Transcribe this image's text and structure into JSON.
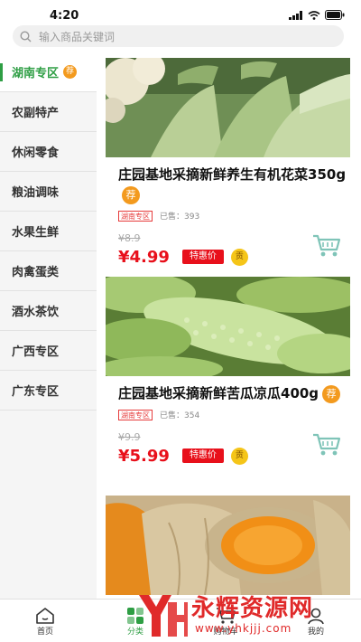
{
  "status_bar": {
    "time": "4:20"
  },
  "search": {
    "placeholder": "输入商品关键词"
  },
  "sidebar": {
    "items": [
      {
        "label": "湖南专区",
        "badge": "荐",
        "active": true
      },
      {
        "label": "农副特产"
      },
      {
        "label": "休闲零食"
      },
      {
        "label": "粮油调味"
      },
      {
        "label": "水果生鲜"
      },
      {
        "label": "肉禽蛋类"
      },
      {
        "label": "酒水茶饮"
      },
      {
        "label": "广西专区"
      },
      {
        "label": "广东专区"
      }
    ]
  },
  "products": [
    {
      "title": "庄园基地采摘新鲜养生有机花菜350g",
      "recommend_badge": "荐",
      "region_tag": "湖南专区",
      "sold": "已售：393",
      "old_price": "¥8.9",
      "price": "¥4.99",
      "deal_label": "特惠价",
      "tribute_badge": "贡",
      "image": "cauliflower-photo"
    },
    {
      "title": "庄园基地采摘新鲜苦瓜凉瓜400g",
      "recommend_badge": "荐",
      "region_tag": "湖南专区",
      "sold": "已售：354",
      "old_price": "¥9.9",
      "price": "¥5.99",
      "deal_label": "特惠价",
      "tribute_badge": "贡",
      "image": "bitter-melon-photo"
    },
    {
      "image": "pumpkin-photo"
    }
  ],
  "bottom_nav": [
    {
      "label": "首页",
      "icon": "home-icon"
    },
    {
      "label": "分类",
      "icon": "category-icon",
      "active": true
    },
    {
      "label": "购物车",
      "icon": "cart-icon"
    },
    {
      "label": "我的",
      "icon": "profile-icon"
    }
  ],
  "watermark": {
    "text": "永辉资源网",
    "url": "www.yhkjjj.com"
  },
  "colors": {
    "accent": "#2e9e44",
    "price": "#e8101b",
    "badge": "#f39a1e",
    "tribute": "#f5c518"
  }
}
